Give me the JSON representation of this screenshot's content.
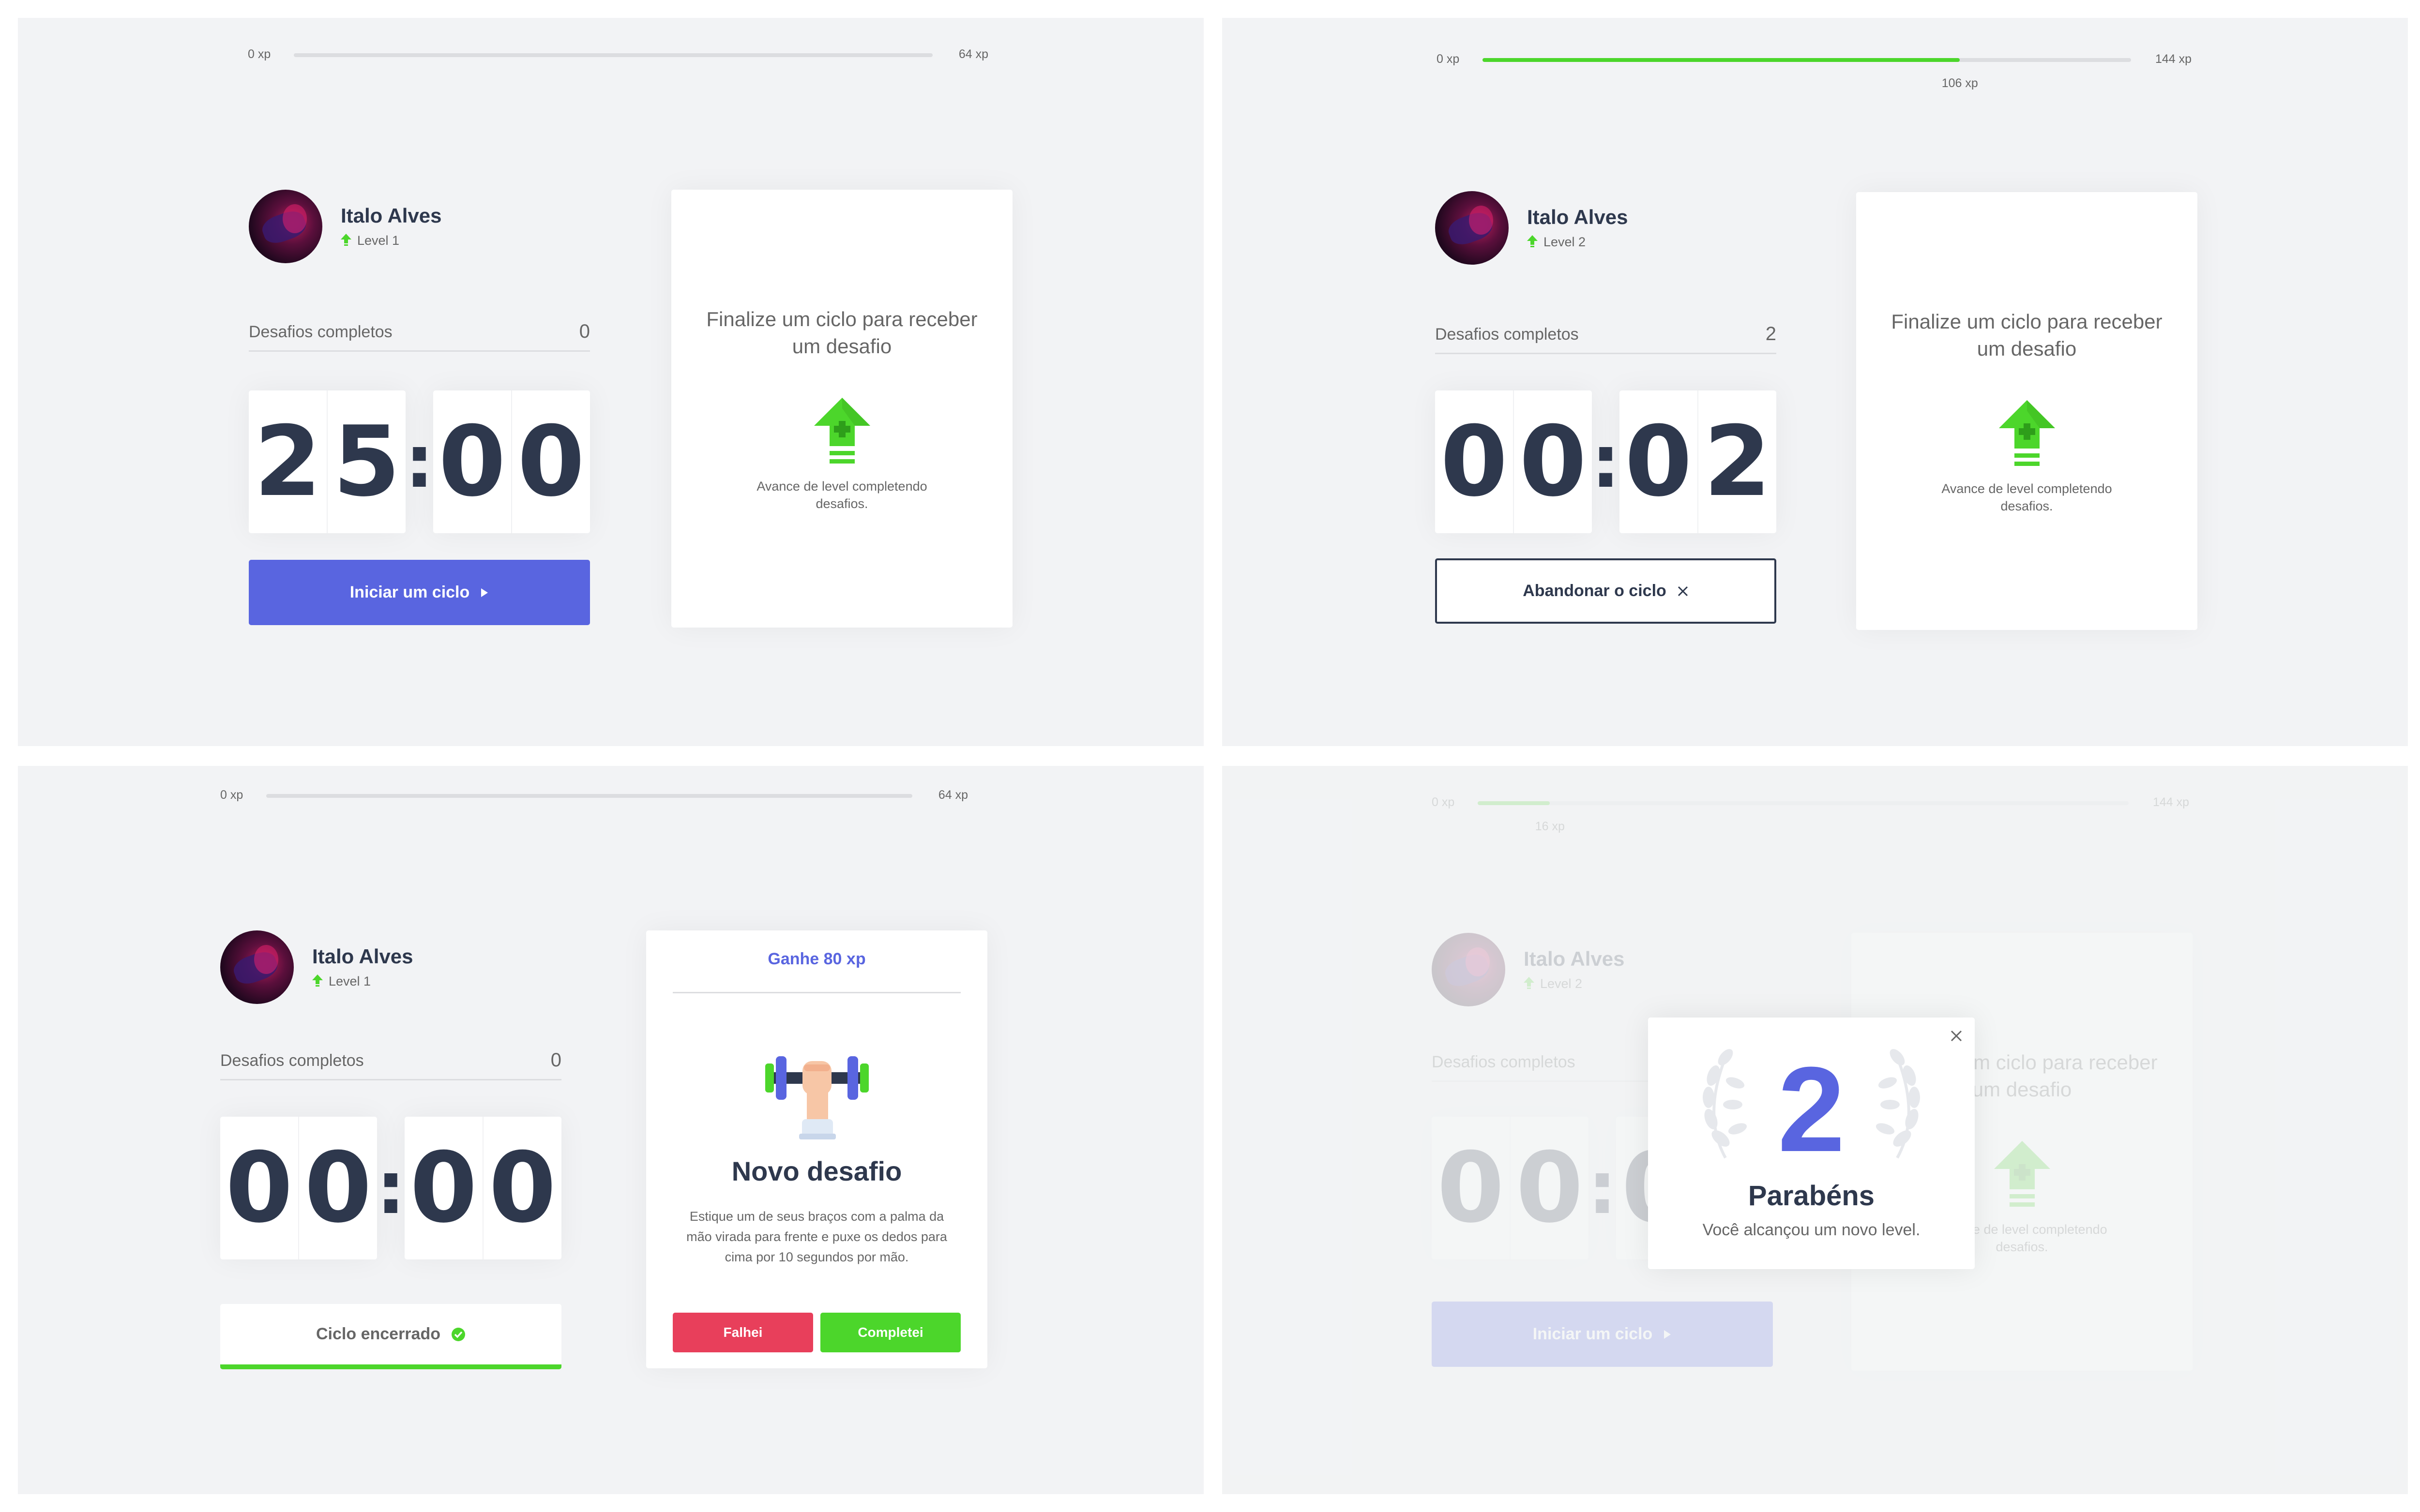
{
  "colors": {
    "background": "#f2f3f5",
    "card": "#ffffff",
    "title": "#2e384d",
    "text": "#666666",
    "blue": "#5965e0",
    "green": "#4cd62b",
    "red": "#e83f5b",
    "gray_line": "#dcdde0"
  },
  "panels": {
    "top_left": {
      "xp": {
        "min": "0 xp",
        "max": "64 xp",
        "current": "",
        "progress_percent": 0
      },
      "profile": {
        "name": "Italo Alves",
        "level": "Level 1"
      },
      "completed": {
        "label": "Desafios completos",
        "count": "0"
      },
      "countdown": {
        "m1": "2",
        "m2": "5",
        "colon": ":",
        "s1": "0",
        "s2": "0"
      },
      "button": {
        "label": "Iniciar um ciclo",
        "icon": "play-icon"
      },
      "challenge": {
        "state": "inactive",
        "title": "Finalize um ciclo para receber um desafio",
        "icon": "level-up-icon",
        "text": "Avance de level completendo desafios."
      }
    },
    "top_right": {
      "xp": {
        "min": "0 xp",
        "max": "144 xp",
        "current": "106 xp",
        "progress_percent": 73.6
      },
      "profile": {
        "name": "Italo Alves",
        "level": "Level 2"
      },
      "completed": {
        "label": "Desafios completos",
        "count": "2"
      },
      "countdown": {
        "m1": "0",
        "m2": "0",
        "colon": ":",
        "s1": "0",
        "s2": "2"
      },
      "button": {
        "label": "Abandonar o ciclo",
        "icon": "close-icon"
      },
      "challenge": {
        "state": "inactive",
        "title": "Finalize um ciclo para receber um desafio",
        "icon": "level-up-icon",
        "text": "Avance de level completendo desafios."
      }
    },
    "bottom_left": {
      "xp": {
        "min": "0 xp",
        "max": "64 xp",
        "current": "",
        "progress_percent": 0
      },
      "profile": {
        "name": "Italo Alves",
        "level": "Level 1"
      },
      "completed": {
        "label": "Desafios completos",
        "count": "0"
      },
      "countdown": {
        "m1": "0",
        "m2": "0",
        "colon": ":",
        "s1": "0",
        "s2": "0"
      },
      "button": {
        "label": "Ciclo encerrado",
        "icon": "check-circle-icon"
      },
      "challenge": {
        "state": "active",
        "gain": "Ganhe 80 xp",
        "icon": "dumbbell-arm-icon",
        "title": "Novo desafio",
        "description": "Estique um de seus braços com a palma da mão virada para frente e puxe os dedos para cima por 10 segundos por mão.",
        "fail_label": "Falhei",
        "success_label": "Completei"
      }
    },
    "bottom_right": {
      "xp": {
        "min": "0 xp",
        "max": "144 xp",
        "current": "16 xp",
        "progress_percent": 11.1
      },
      "profile": {
        "name": "Italo Alves",
        "level": "Level 2"
      },
      "completed": {
        "label": "Desafios completos",
        "count": ""
      },
      "countdown": {
        "m1": "0",
        "m2": "0",
        "colon": ":",
        "s1": "0",
        "s2": ""
      },
      "button": {
        "label": "Iniciar um ciclo",
        "icon": "play-icon"
      },
      "challenge": {
        "state": "inactive",
        "title": "Finalize um ciclo para receber um desafio",
        "icon": "level-up-icon",
        "text": "Avance de level completendo desafios."
      },
      "modal": {
        "level": "2",
        "title": "Parabéns",
        "text": "Você alcançou um novo level.",
        "close_icon": "close-icon",
        "decoration_icon": "laurel-icon"
      }
    }
  }
}
